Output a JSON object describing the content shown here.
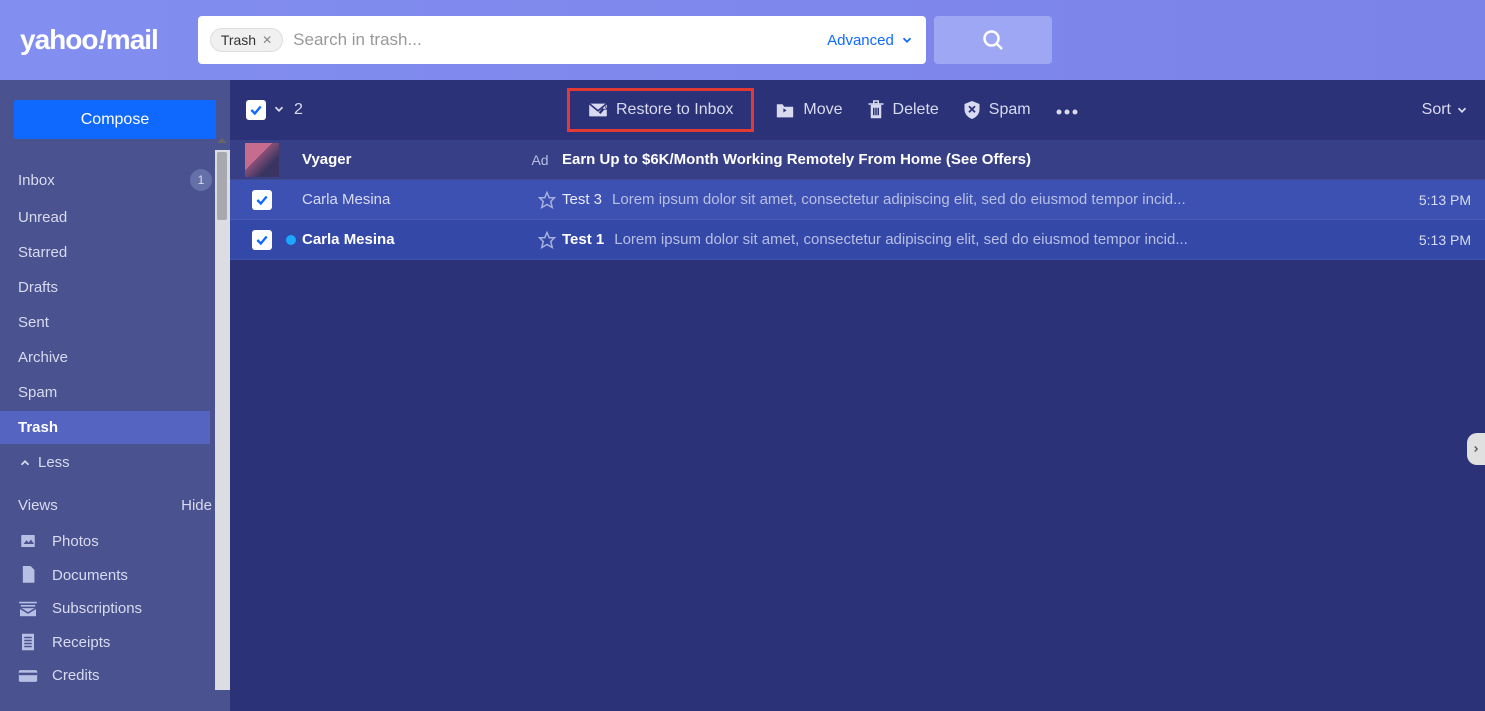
{
  "logo_prefix": "yahoo",
  "logo_suffix": "mail",
  "search": {
    "chip_label": "Trash",
    "placeholder": "Search in trash...",
    "advanced_label": "Advanced"
  },
  "compose_label": "Compose",
  "nav": {
    "inbox": {
      "label": "Inbox",
      "count": "1"
    },
    "unread": {
      "label": "Unread"
    },
    "starred": {
      "label": "Starred"
    },
    "drafts": {
      "label": "Drafts"
    },
    "sent": {
      "label": "Sent"
    },
    "archive": {
      "label": "Archive"
    },
    "spam": {
      "label": "Spam"
    },
    "trash": {
      "label": "Trash"
    },
    "less": {
      "label": "Less"
    }
  },
  "views": {
    "header": "Views",
    "hide": "Hide",
    "photos": "Photos",
    "documents": "Documents",
    "subscriptions": "Subscriptions",
    "receipts": "Receipts",
    "credits": "Credits"
  },
  "toolbar": {
    "selected_count": "2",
    "restore": "Restore to Inbox",
    "move": "Move",
    "delete": "Delete",
    "spam": "Spam",
    "sort": "Sort"
  },
  "ad": {
    "sender": "Vyager",
    "badge": "Ad",
    "headline": "Earn Up to $6K/Month Working Remotely From Home (See Offers)"
  },
  "messages": [
    {
      "sender": "Carla Mesina",
      "subject": "Test 3",
      "preview": "Lorem ipsum dolor sit amet, consectetur adipiscing elit, sed do eiusmod tempor incid...",
      "time": "5:13 PM",
      "unread": false,
      "selected": true
    },
    {
      "sender": "Carla Mesina",
      "subject": "Test 1",
      "preview": "Lorem ipsum dolor sit amet, consectetur adipiscing elit, sed do eiusmod tempor incid...",
      "time": "5:13 PM",
      "unread": true,
      "selected": true
    }
  ]
}
